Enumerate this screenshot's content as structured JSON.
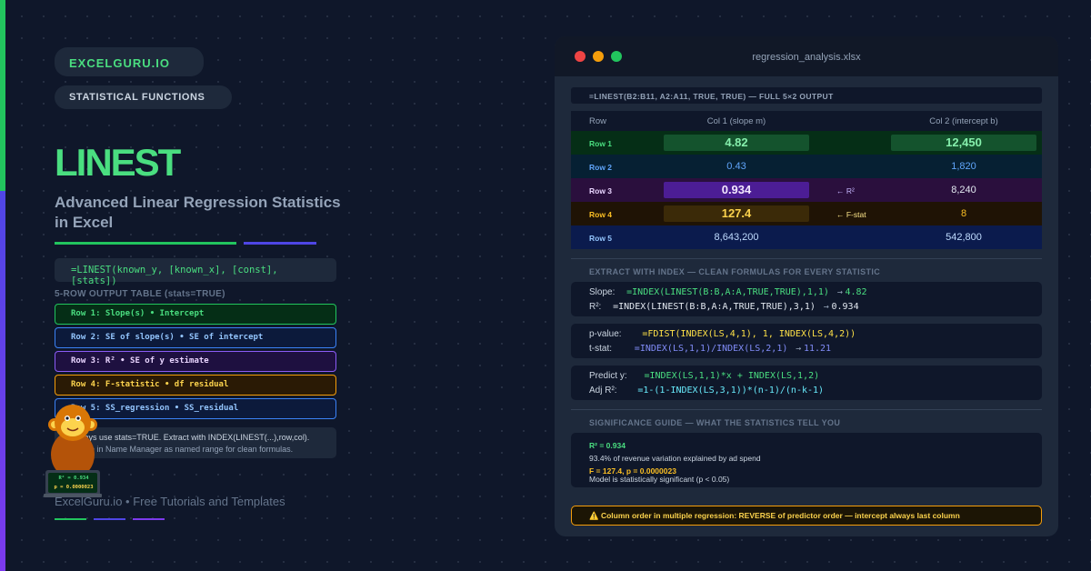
{
  "brand": "EXCELGURU.IO",
  "category": "STATISTICAL FUNCTIONS",
  "title": "LINEST",
  "subtitle": "Advanced Linear Regression Statistics in Excel",
  "syntax": "=LINEST(known_y, [known_x], [const], [stats])",
  "output_label": "5-ROW OUTPUT TABLE (stats=TRUE)",
  "rows_legend": [
    "Row 1: Slope(s) • Intercept",
    "Row 2: SE of slope(s) • SE of intercept",
    "Row 3: R² • SE of y estimate",
    "Row 4: F-statistic • df residual",
    "Row 5: SS_regression • SS_residual"
  ],
  "tip": {
    "line1": "Always use stats=TRUE. Extract with INDEX(LINEST(...),row,col).",
    "line2": "Define in Name Manager as named range for clean formulas."
  },
  "footer": "ExcelGuru.io • Free Tutorials and Templates",
  "mascot_screen": {
    "line1": "R² = 0.934",
    "line2": "p = 0.0000023"
  },
  "panel": {
    "filename": "regression_analysis.xlsx",
    "formula_bar": "=LINEST(B2:B11, A2:A11, TRUE, TRUE) — FULL 5×2 OUTPUT",
    "table": {
      "headers": [
        "Row",
        "Col 1 (slope m)",
        "Col 2 (intercept b)"
      ],
      "rows": [
        {
          "label": "Row 1",
          "col1": "4.82",
          "col2": "12,450",
          "note": ""
        },
        {
          "label": "Row 2",
          "col1": "0.43",
          "col2": "1,820",
          "note": ""
        },
        {
          "label": "Row 3",
          "col1": "0.934",
          "col2": "8,240",
          "note": "← R²"
        },
        {
          "label": "Row 4",
          "col1": "127.4",
          "col2": "8",
          "note": "← F-stat"
        },
        {
          "label": "Row 5",
          "col1": "8,643,200",
          "col2": "542,800",
          "note": ""
        }
      ]
    },
    "extract_label": "EXTRACT WITH INDEX — CLEAN FORMULAS FOR EVERY STATISTIC",
    "formula_groups": [
      [
        {
          "label": "Slope:",
          "formula": "=INDEX(LINEST(B:B,A:A,TRUE,TRUE),1,1)",
          "result": "4.82"
        },
        {
          "label": "R²:",
          "formula": "=INDEX(LINEST(B:B,A:A,TRUE,TRUE),3,1)",
          "result": "0.934"
        }
      ],
      [
        {
          "label": "p-value:",
          "formula": "=FDIST(INDEX(LS,4,1), 1, INDEX(LS,4,2))",
          "result": ""
        },
        {
          "label": "t-stat:",
          "formula": "=INDEX(LS,1,1)/INDEX(LS,2,1)",
          "result": "11.21"
        }
      ],
      [
        {
          "label": "Predict y:",
          "formula": "=INDEX(LS,1,1)*x + INDEX(LS,1,2)",
          "result": ""
        },
        {
          "label": "Adj R²:",
          "formula": "=1-(1-INDEX(LS,3,1))*(n-1)/(n-k-1)",
          "result": ""
        }
      ]
    ],
    "significance_label": "SIGNIFICANCE GUIDE — WHAT THE STATISTICS TELL YOU",
    "significance": {
      "r2_head": "R² = 0.934",
      "r2_desc": "93.4% of revenue variation explained by ad spend",
      "f_head": "F = 127.4, p = 0.0000023",
      "f_desc": "Model is statistically significant (p < 0.05)"
    },
    "warning": "⚠️ Column order in multiple regression: REVERSE of predictor order — intercept always last column"
  },
  "colors": {
    "accent_green": "#4ade80",
    "accent_indigo": "#4f46e5",
    "accent_purple": "#7c3aed",
    "background": "#0f172a",
    "panel": "#1e293b",
    "warning": "#f59e0b"
  }
}
